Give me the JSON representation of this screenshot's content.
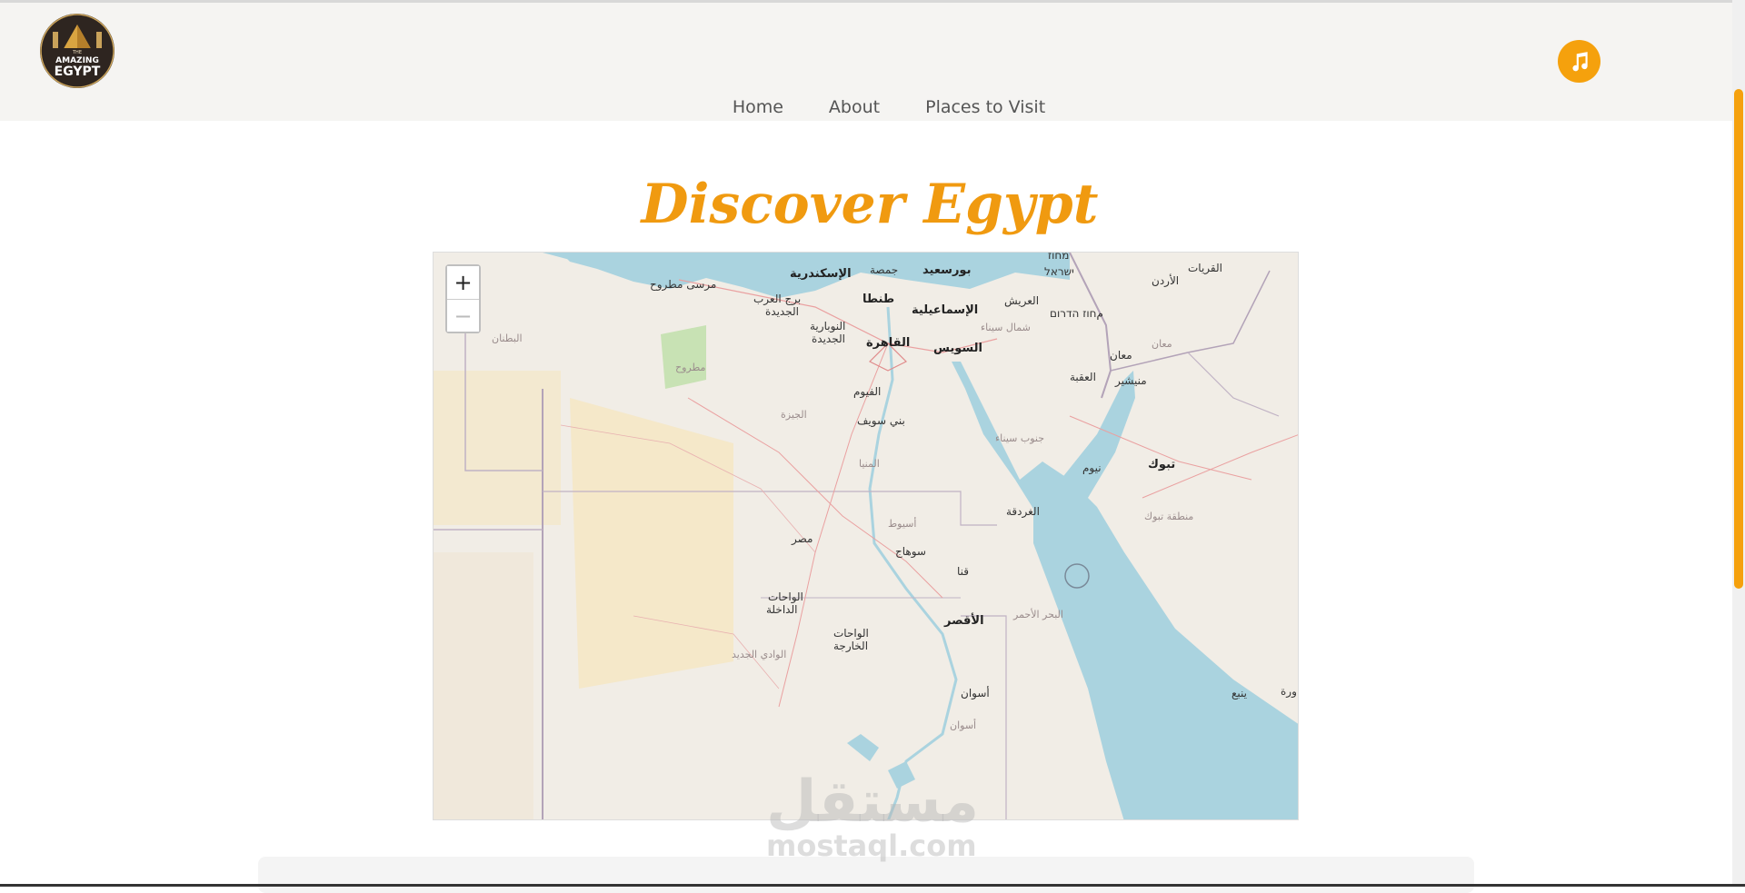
{
  "header": {
    "logo": {
      "icon": "amazing-egypt-logo",
      "line1": "THE",
      "line2": "AMAZING",
      "line3": "EGYPT"
    },
    "music_icon": "music-note-icon",
    "nav": [
      {
        "label": "Home"
      },
      {
        "label": "About"
      },
      {
        "label": "Places to Visit"
      }
    ]
  },
  "main": {
    "title": "Discover Egypt"
  },
  "map": {
    "zoom_in": "+",
    "zoom_out": "−",
    "labels": [
      "الإسكندرية",
      "جمصة",
      "بورسعيد",
      "מחוז",
      "ישראל",
      "القريات",
      "مرسى مطروح",
      "برج العرب",
      "الجديدة",
      "طنطا",
      "الإسماعيلية",
      "العريش",
      "الأردن",
      "مחוז הדרום",
      "النوبارية",
      "الجديدة",
      "شمال سيناء",
      "البطنان",
      "مطروح",
      "القاهرة",
      "السويس",
      "معان",
      "معان",
      "العقبة",
      "منيشير",
      "الفيوم",
      "الجيزة",
      "بني سويف",
      "جنوب سيناء",
      "نيوم",
      "تبوك",
      "المنيا",
      "الغردقة",
      "أسيوط",
      "منطقة تبوك",
      "مصر",
      "سوهاج",
      "قنا",
      "الواحات",
      "الداخلة",
      "الأقصر",
      "البحر الأحمر",
      "الواحات",
      "الخارجة",
      "الوادي الجديد",
      "أسوان",
      "أسوان",
      "ينبع",
      "ورة"
    ]
  },
  "watermark": {
    "ar": "مستقل",
    "en": "mostaql.com"
  },
  "colors": {
    "accent": "#f5a10d",
    "title": "#f09a10",
    "sea": "#aad3df"
  }
}
